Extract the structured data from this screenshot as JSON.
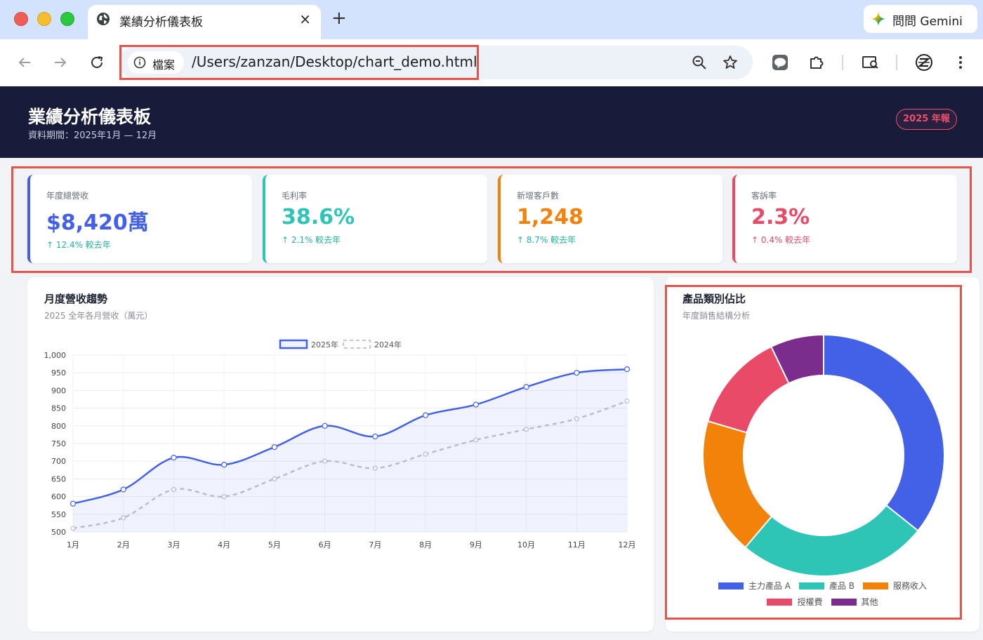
{
  "browser": {
    "tab_title": "業績分析儀表板",
    "tab_close": "×",
    "new_tab": "+",
    "gemini_label": "問問 Gemini",
    "site_label": "檔案",
    "url": "/Users/zanzan/Desktop/chart_demo.html"
  },
  "header": {
    "title": "業績分析儀表板",
    "subtitle": "資料期間：2025年1月 — 12月",
    "badge": "2025 年報"
  },
  "kpis": [
    {
      "label": "年度總營收",
      "value": "$8,420萬",
      "change": "↑ 12.4% 較去年",
      "accent": "#4361e6",
      "value_color": "#4361e6",
      "change_color": "#22b3a3"
    },
    {
      "label": "毛利率",
      "value": "38.6%",
      "change": "↑ 2.1% 較去年",
      "accent": "#2ec4b6",
      "value_color": "#2ec4b6",
      "change_color": "#22b3a3"
    },
    {
      "label": "新增客戶數",
      "value": "1,248",
      "change": "↑ 8.7% 較去年",
      "accent": "#f2820a",
      "value_color": "#f2820a",
      "change_color": "#22b3a3"
    },
    {
      "label": "客訴率",
      "value": "2.3%",
      "change": "↑ 0.4% 較去年",
      "accent": "#e84a67",
      "value_color": "#e84a67",
      "change_color": "#e84a67"
    }
  ],
  "trend_card": {
    "title": "月度營收趨勢",
    "subtitle": "2025 全年各月營收（萬元）"
  },
  "pie_card": {
    "title": "產品類別佔比",
    "subtitle": "年度銷售結構分析"
  },
  "chart_data": [
    {
      "type": "line",
      "categories": [
        "1月",
        "2月",
        "3月",
        "4月",
        "5月",
        "6月",
        "7月",
        "8月",
        "9月",
        "10月",
        "11月",
        "12月"
      ],
      "series": [
        {
          "name": "2025年",
          "values": [
            580,
            620,
            710,
            690,
            740,
            800,
            770,
            830,
            860,
            910,
            950,
            960
          ],
          "color": "#4361e6",
          "style": "solid",
          "fill": true
        },
        {
          "name": "2024年",
          "values": [
            510,
            540,
            620,
            600,
            650,
            700,
            680,
            720,
            760,
            790,
            820,
            870
          ],
          "color": "#c3c6cf",
          "style": "dashed",
          "fill": false
        }
      ],
      "yticks": [
        "500",
        "550",
        "600",
        "650",
        "700",
        "750",
        "800",
        "850",
        "900",
        "950",
        "1,000"
      ],
      "ylim": [
        500,
        1000
      ],
      "grid": true,
      "legend": "top-center"
    },
    {
      "type": "pie",
      "variant": "doughnut",
      "labels": [
        "主力產品 A",
        "產品 B",
        "服務收入",
        "授權費",
        "其他"
      ],
      "values": [
        35,
        25,
        18,
        13,
        7
      ],
      "colors": [
        "#4361e6",
        "#2ec4b6",
        "#f2820a",
        "#e84a67",
        "#7b2d8e"
      ],
      "legend": "bottom"
    }
  ]
}
